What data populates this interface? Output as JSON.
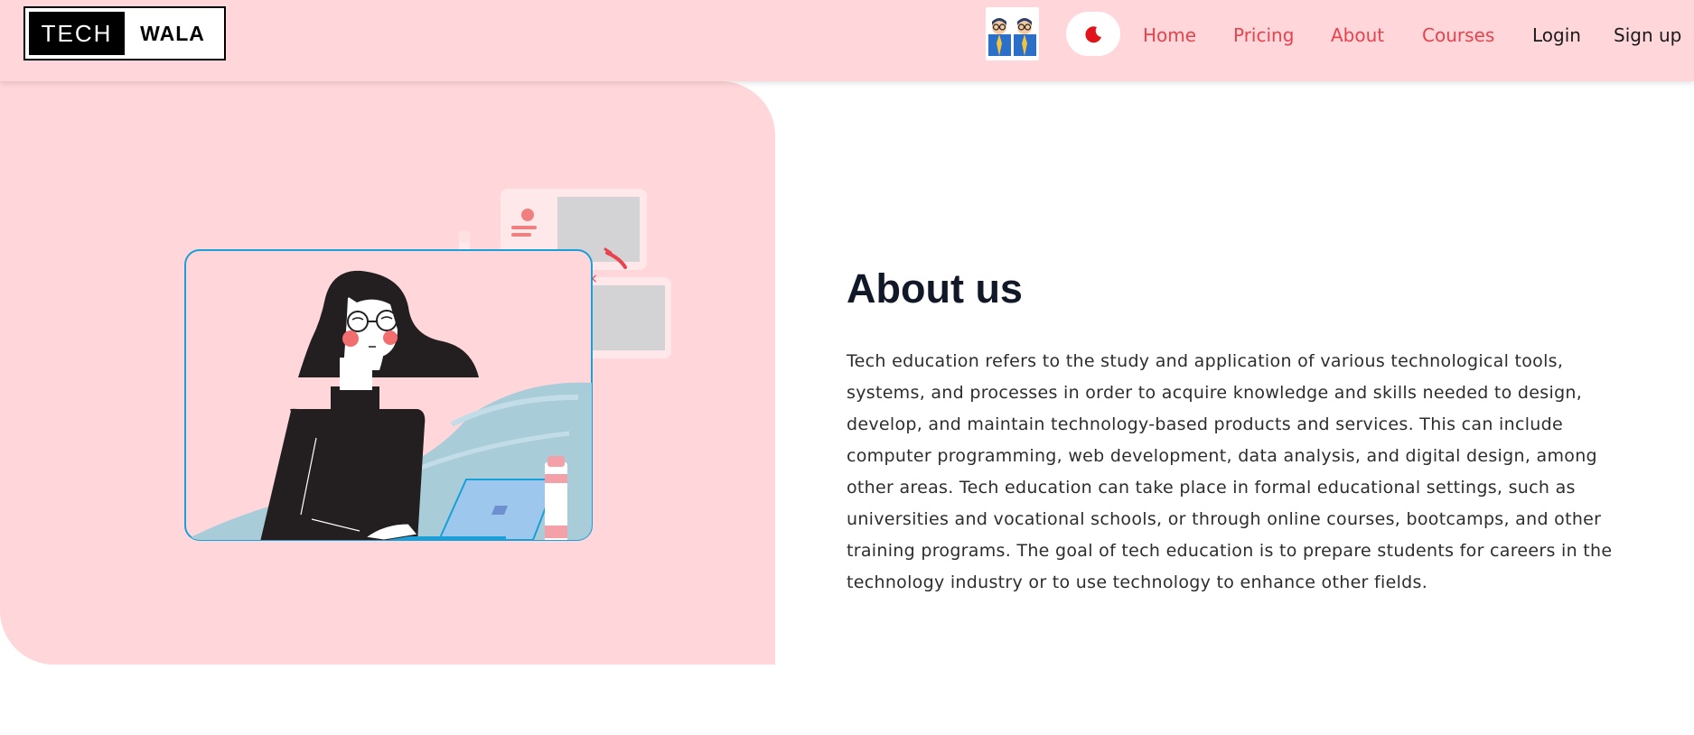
{
  "logo": {
    "part1": "TECH",
    "part2": "WALA"
  },
  "nav": {
    "avatar_icon": "team-avatar-icon",
    "theme_icon": "moon-icon",
    "links": [
      {
        "label": "Home"
      },
      {
        "label": "Pricing"
      },
      {
        "label": "About"
      },
      {
        "label": "Courses"
      }
    ],
    "login_label": "Login",
    "signup_label": "Sign up"
  },
  "about": {
    "title": "About us",
    "body": "Tech education refers to the study and application of various technological tools, systems, and processes in order to acquire knowledge and skills needed to design, develop, and maintain technology-based products and services. This can include computer programming, web development, data analysis, and digital design, among other areas. Tech education can take place in formal educational settings, such as universities and vocational schools, or through online courses, bootcamps, and other training programs. The goal of tech education is to prepare students for careers in the technology industry or to use technology to enhance other fields."
  },
  "colors": {
    "navbar_bg": "#ffd6d9",
    "accent": "#e8434d",
    "text_dark": "#111827"
  }
}
